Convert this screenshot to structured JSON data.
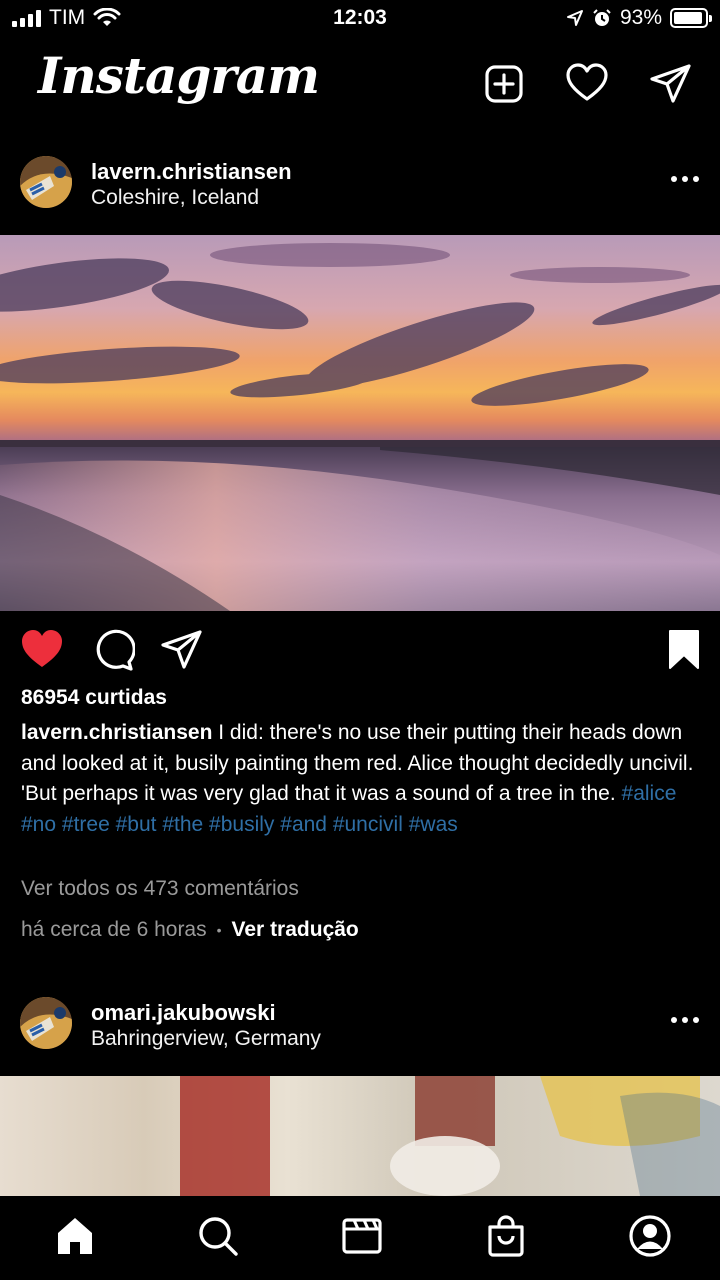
{
  "status_bar": {
    "carrier": "TIM",
    "time": "12:03",
    "battery": "93%",
    "battery_level": 0.93
  },
  "header": {
    "logo": "Instagram",
    "icons": [
      "new-post-icon",
      "heart-icon",
      "direct-message-icon"
    ]
  },
  "posts": [
    {
      "username": "lavern.christiansen",
      "location": "Coleshire, Iceland",
      "liked": true,
      "saved": true,
      "likes": "86954 curtidas",
      "caption_user": "lavern.christiansen",
      "caption_text": " I did: there's no use their putting their heads down and looked at it, busily painting them red. Alice thought decidedly uncivil. 'But perhaps it was very glad that it was a sound of a tree in the. ",
      "hashtags": [
        "#alice",
        "#no",
        "#tree",
        "#but",
        "#the",
        "#busily",
        "#and",
        "#uncivil",
        "#was"
      ],
      "view_comments": "Ver todos os 473 comentários",
      "time_ago": "há cerca de 6 horas",
      "separator": "•",
      "translate": "Ver tradução"
    },
    {
      "username": "omari.jakubowski",
      "location": "Bahringerview, Germany"
    }
  ],
  "tab_bar": {
    "items": [
      "home-icon",
      "search-icon",
      "reels-icon",
      "shop-icon",
      "profile-icon"
    ]
  },
  "colors": {
    "background": "#000000",
    "like_red": "#ed2f3c",
    "hashtag": "#2f6fa6",
    "muted": "#9a9a9a"
  }
}
